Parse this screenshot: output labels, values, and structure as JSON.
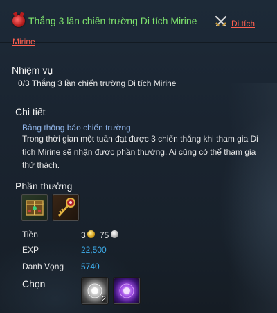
{
  "header": {
    "quest_title": "Thắng 3 lần chiến trường Di tích Mirine",
    "location_link": "Di tích Mirine"
  },
  "mission": {
    "label": "Nhiệm vụ",
    "progress_text": "0/3 Thắng 3 lần chiến trường Di tích Mirine"
  },
  "details": {
    "label": "Chi tiết",
    "subheading": "Bảng thông báo chiến trường",
    "description": "Trong thời gian một tuần đạt được 3 chiến thắng khi tham gia Di tích Mirine sẽ nhận được phần thưởng. Ai cũng có thể tham gia thử thách."
  },
  "rewards": {
    "label": "Phần thưởng",
    "items": [
      {
        "icon": "treasure-box-icon"
      },
      {
        "icon": "golden-key-icon"
      }
    ],
    "money": {
      "label": "Tiền",
      "gold": "3",
      "silver": "75"
    },
    "exp": {
      "label": "EXP",
      "value": "22,500"
    },
    "reputation": {
      "label": "Danh Vọng",
      "value": "5740"
    },
    "choose": {
      "label": "Chọn",
      "items": [
        {
          "icon": "white-orb-icon",
          "quantity": "2"
        },
        {
          "icon": "purple-orb-icon",
          "quantity": ""
        }
      ]
    }
  },
  "colors": {
    "title_green": "#7ee36d",
    "link_red": "#ff5f4f",
    "subheading_blue": "#8fb4e8",
    "value_blue": "#3fb0f0"
  }
}
